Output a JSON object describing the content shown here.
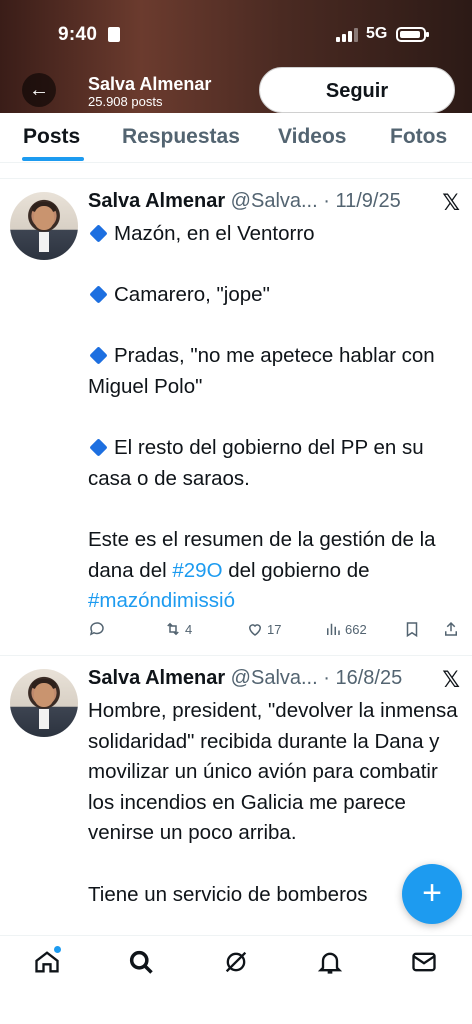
{
  "status_bar": {
    "time": "9:40",
    "network": "5G"
  },
  "header": {
    "back_icon": "arrow-left-icon",
    "name": "Salva Almenar",
    "posts_count": "25.908 posts",
    "follow_label": "Seguir"
  },
  "tabs": [
    {
      "label": "Posts",
      "active": true
    },
    {
      "label": "Respuestas",
      "active": false
    },
    {
      "label": "Videos",
      "active": false
    },
    {
      "label": "Fotos",
      "active": false
    }
  ],
  "posts": [
    {
      "author": "Salva Almenar",
      "handle": "@Salva...",
      "date": "· 11/9/25",
      "lines": [
        {
          "type": "bullet",
          "text": "Mazón, en el Ventorro"
        },
        {
          "type": "bullet",
          "text": "Camarero, \"jope\""
        },
        {
          "type": "bullet",
          "text": "Pradas, \"no me apetece hablar con Miguel Polo\""
        },
        {
          "type": "bullet",
          "text": "El resto del gobierno del PP en su casa o de saraos."
        }
      ],
      "closing": {
        "text1": "Este es el resumen de la gestión de la dana del ",
        "hashtag1": "#29O",
        "text2": " del gobierno de ",
        "hashtag2": "#mazóndimissió"
      },
      "stats": {
        "replies": "",
        "reposts": "4",
        "likes": "17",
        "views": "662"
      }
    },
    {
      "author": "Salva Almenar",
      "handle": "@Salva...",
      "date": "· 16/8/25",
      "paragraph1": "Hombre, president, \"devolver la inmensa solidaridad\" recibida durante la Dana y movilizar un único avión para combatir los incendios en Galicia me parece venirse un poco arriba.",
      "paragraph2": "Tiene un servicio de bomberos"
    }
  ],
  "fab": {
    "icon": "plus-icon",
    "label": "+"
  },
  "bottom_nav": [
    "home-icon",
    "search-icon",
    "grok-icon",
    "bell-icon",
    "mail-icon"
  ],
  "colors": {
    "accent": "#1d9bf0",
    "text": "#0f1419",
    "secondary": "#536471"
  }
}
